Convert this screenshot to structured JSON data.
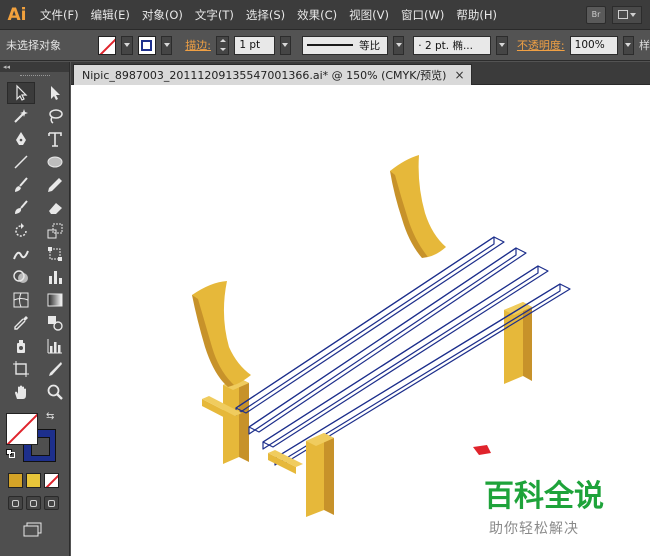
{
  "app": {
    "logo": "Ai"
  },
  "menu": {
    "items": [
      "文件(F)",
      "编辑(E)",
      "对象(O)",
      "文字(T)",
      "选择(S)",
      "效果(C)",
      "视图(V)",
      "窗口(W)",
      "帮助(H)"
    ],
    "bridge_label": "Br"
  },
  "control": {
    "selection": "未选择对象",
    "stroke_label": "描边:",
    "stroke_weight": "1 pt",
    "profile": "等比",
    "brush": "· 2 pt. 椭...",
    "opacity_label": "不透明度:",
    "opacity": "100%",
    "overflow": "样"
  },
  "toolpanel": {
    "collapse": "◂◂"
  },
  "document": {
    "tab_title": "Nipic_8987003_20111209135547001366.ai* @ 150% (CMYK/预览)",
    "close": "×"
  },
  "colors": {
    "stroke": "#1d2f8c",
    "wood_light": "#e6b83a",
    "wood_dark": "#c7922a",
    "none_slash": "#e0242c"
  },
  "watermark": {
    "main": "百科全说",
    "sub": "助你轻松解决"
  }
}
